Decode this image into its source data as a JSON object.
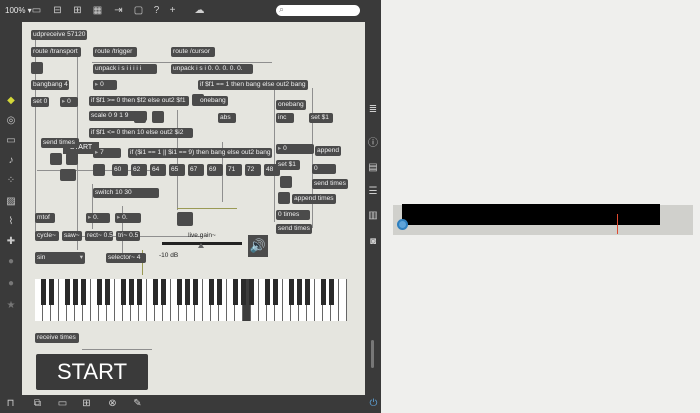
{
  "toolbar": {
    "zoom": "100% ▾",
    "search_placeholder": ""
  },
  "objects": {
    "udpreceive": "udpreceive 57120",
    "route_transport": "route /transport",
    "route_trigger": "route /trigger",
    "route_cursor": "route /cursor",
    "unpack1": "unpack i s i i i i i",
    "unpack2": "unpack i s i 0. 0. 0. 0. 0.",
    "bangbang": "bangbang 4",
    "set0": "set 0",
    "num0": "0",
    "start_small": "START",
    "send_times1": "send times",
    "num_gt0": "0",
    "if1": "if $f1 >= 0 then $f2 else out2 $f1",
    "if2": "if $f1 == 1 then bang else out2 bang",
    "scale": "scale 0 9 1 9",
    "if3": "if $f1 <= 0 then 10 else out2 $i2",
    "onebang1": "onebang",
    "onebang2": "onebang",
    "abs": "abs",
    "inc": "inc",
    "set1": "set $1",
    "num7": "7",
    "if4": "if ($i1 == 1 || $i1 == 9) then bang else out2 bang",
    "notes": [
      "60",
      "62",
      "64",
      "65",
      "67",
      "69",
      "71",
      "72",
      "48"
    ],
    "switch": "switch 10 30",
    "mtof": "mtof",
    "float1": "0.",
    "float2": "0.",
    "cycle": "cycle~",
    "saw": "saw~",
    "rect": "rect~ 0.5",
    "tri": "tri~ 0.5",
    "sin_menu": "sin",
    "selector": "selector~ 4",
    "live_gain": "live.gain~",
    "gain_db": "-10 dB",
    "num_r1": "0",
    "set_r": "set $1",
    "append1": "append",
    "num_r2": "0",
    "send_times2": "send times",
    "append_times": "append times",
    "times0": "0 times",
    "send_times3": "send times",
    "receive_times": "receive times",
    "start_big": "START"
  },
  "colors": {
    "canvas": "#e5e5df",
    "object": "#4b4b4b",
    "chrome": "#3a3a3a",
    "accent": "#5ea3d9",
    "playhead": "#e04a30"
  }
}
